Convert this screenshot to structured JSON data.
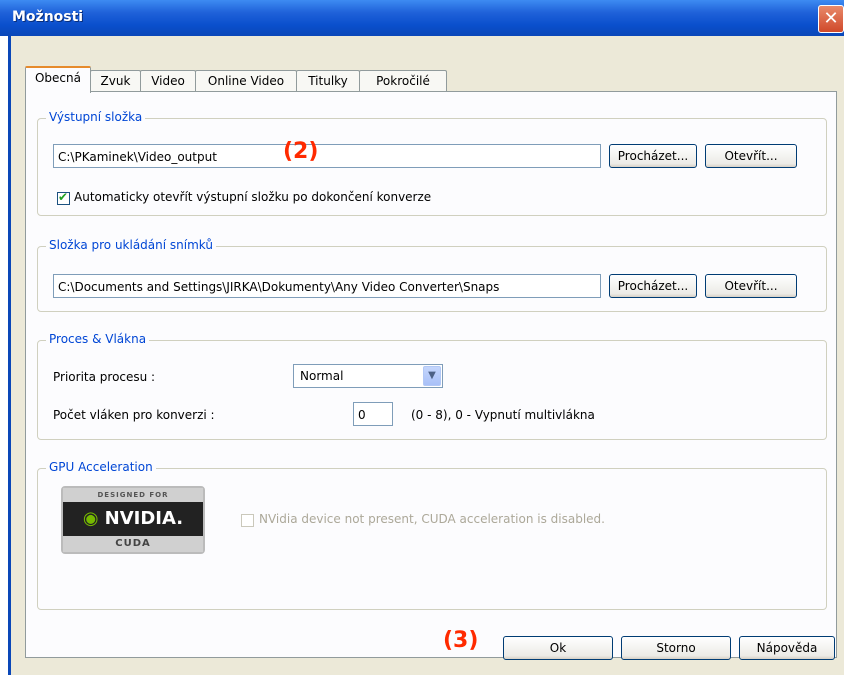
{
  "window": {
    "title": "Možnosti",
    "close_glyph": "✕"
  },
  "tabs": [
    "Obecná",
    "Zvuk",
    "Video",
    "Online Video",
    "Titulky",
    "Pokročilé"
  ],
  "output_folder": {
    "legend": "Výstupní složka",
    "path": "C:\\PKaminek\\Video_output",
    "browse_label": "Procházet...",
    "open_label": "Otevřít...",
    "auto_open_checked": true,
    "auto_open_label": "Automaticky otevřít výstupní složku po dokončení konverze"
  },
  "snapshot_folder": {
    "legend": "Složka pro ukládání snímků",
    "path": "C:\\Documents and Settings\\JIRKA\\Dokumenty\\Any Video Converter\\Snaps",
    "browse_label": "Procházet...",
    "open_label": "Otevřít..."
  },
  "process": {
    "legend": "Proces & Vlákna",
    "priority_label": "Priorita procesu :",
    "priority_value": "Normal",
    "threads_label": "Počet vláken pro konverzi :",
    "threads_value": "0",
    "threads_hint": "(0 - 8), 0 - Vypnutí multivlákna"
  },
  "gpu": {
    "legend": "GPU Acceleration",
    "logo_top": "DESIGNED FOR",
    "logo_mid": "NVIDIA.",
    "logo_bottom": "CUDA",
    "cuda_label": "NVidia device not present, CUDA acceleration is disabled.",
    "cuda_checked": false
  },
  "footer": {
    "ok_label": "Ok",
    "cancel_label": "Storno",
    "help_label": "Nápověda"
  },
  "annotations": {
    "a2": "(2)",
    "a3": "(3)"
  },
  "colors": {
    "titlebar": "#0a4fcc",
    "legend_text": "#0046d5",
    "annotation": "#ff2a00",
    "tab_active_accent": "#e68b2c"
  }
}
